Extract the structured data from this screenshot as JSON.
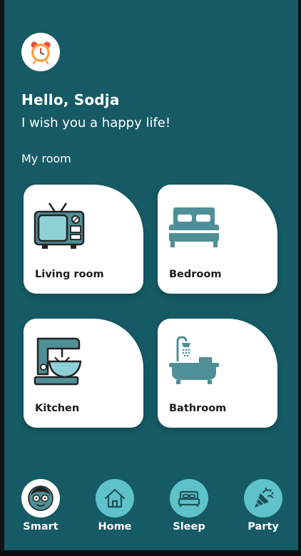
{
  "header": {
    "avatar_icon": "alarm-clock-icon",
    "greeting": "Hello, Sodja",
    "subtitle": "I wish you a happy life!",
    "section_label": "My room"
  },
  "rooms": [
    {
      "label": "Living room",
      "icon": "tv-icon"
    },
    {
      "label": "Bedroom",
      "icon": "bed-icon"
    },
    {
      "label": "Kitchen",
      "icon": "stand-mixer-icon"
    },
    {
      "label": "Bathroom",
      "icon": "bathtub-icon"
    }
  ],
  "nav": [
    {
      "label": "Smart",
      "icon": "smart-face-icon",
      "active": true
    },
    {
      "label": "Home",
      "icon": "home-icon",
      "active": false
    },
    {
      "label": "Sleep",
      "icon": "bed-icon",
      "active": false
    },
    {
      "label": "Party",
      "icon": "party-popper-icon",
      "active": false
    }
  ],
  "colors": {
    "background": "#155a64",
    "accent": "#5fc1c9",
    "icon_teal": "#4f8f97",
    "card": "#ffffff"
  }
}
